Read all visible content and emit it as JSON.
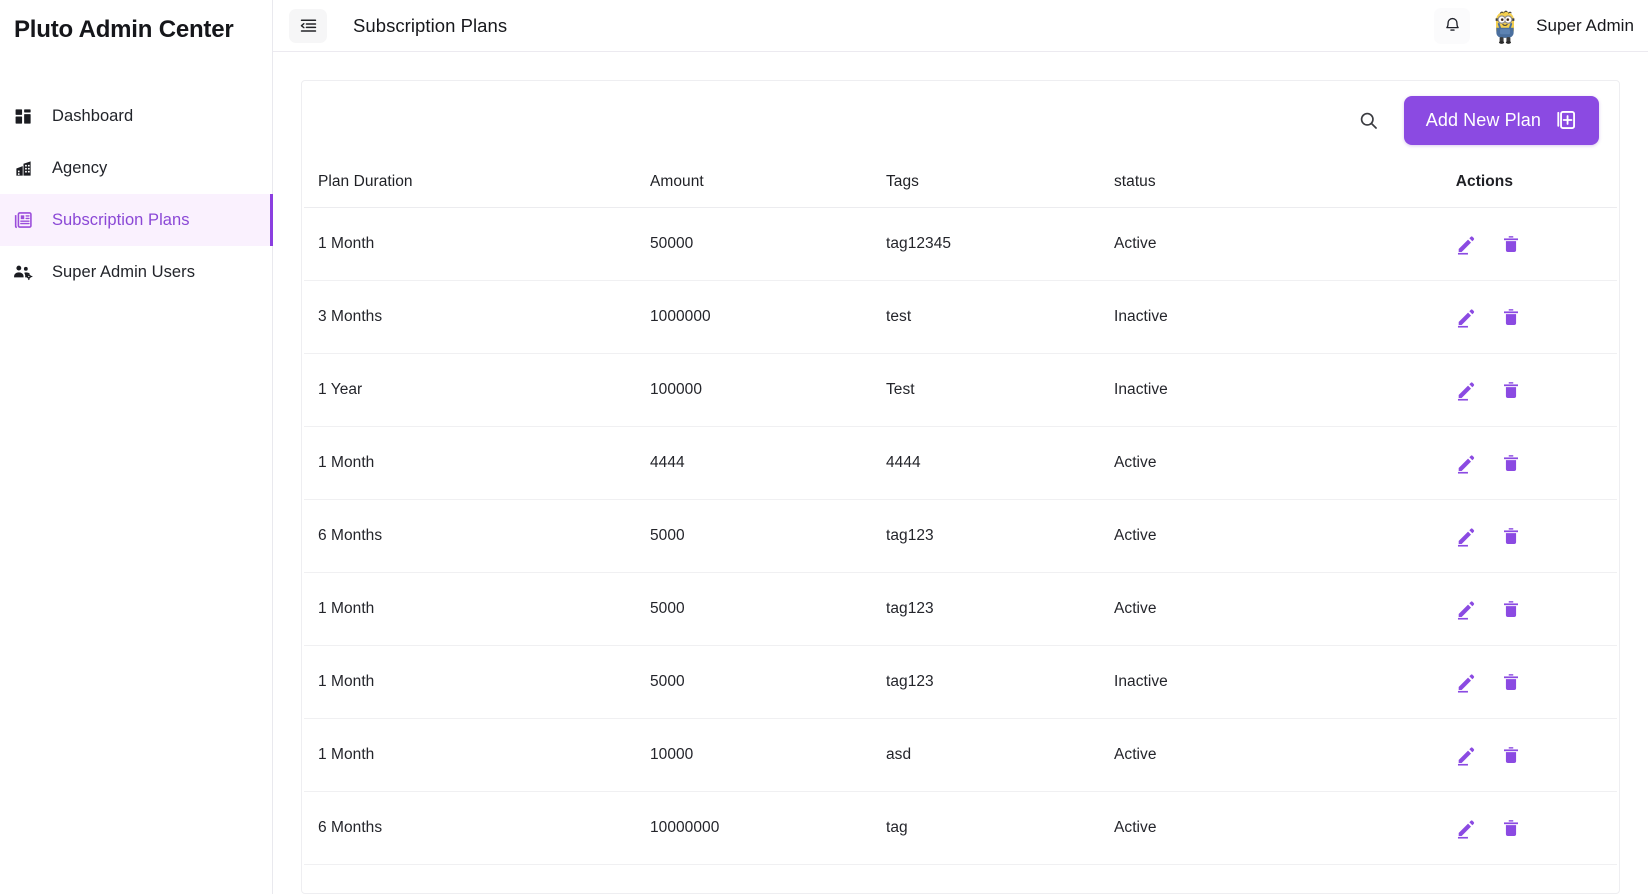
{
  "sidebar": {
    "brand": "Pluto Admin Center",
    "items": [
      {
        "label": "Dashboard",
        "icon": "dashboard-icon",
        "active": false
      },
      {
        "label": "Agency",
        "icon": "building-icon",
        "active": false
      },
      {
        "label": "Subscription Plans",
        "icon": "newspaper-icon",
        "active": true
      },
      {
        "label": "Super Admin Users",
        "icon": "people-gear-icon",
        "active": false
      }
    ]
  },
  "topbar": {
    "collapse_icon": "menu-collapse-icon",
    "title": "Subscription Plans",
    "bell_icon": "bell-icon",
    "avatar_icon": "minion-avatar",
    "user_name": "Super Admin"
  },
  "toolbar": {
    "search_icon": "search-icon",
    "add_label": "Add New Plan",
    "add_icon": "library-add-icon"
  },
  "table": {
    "columns": [
      "Plan Duration",
      "Amount",
      "Tags",
      "status",
      "Actions"
    ],
    "row_actions": {
      "edit_icon": "edit-pencil-icon",
      "delete_icon": "trash-icon"
    },
    "rows": [
      {
        "duration": "1 Month",
        "amount": "50000",
        "tags": "tag12345",
        "status": "Active"
      },
      {
        "duration": "3 Months",
        "amount": "1000000",
        "tags": "test",
        "status": "Inactive"
      },
      {
        "duration": "1 Year",
        "amount": "100000",
        "tags": "Test",
        "status": "Inactive"
      },
      {
        "duration": "1 Month",
        "amount": "4444",
        "tags": "4444",
        "status": "Active"
      },
      {
        "duration": "6 Months",
        "amount": "5000",
        "tags": "tag123",
        "status": "Active"
      },
      {
        "duration": "1 Month",
        "amount": "5000",
        "tags": "tag123",
        "status": "Active"
      },
      {
        "duration": "1 Month",
        "amount": "5000",
        "tags": "tag123",
        "status": "Inactive"
      },
      {
        "duration": "1 Month",
        "amount": "10000",
        "tags": "asd",
        "status": "Active"
      },
      {
        "duration": "6 Months",
        "amount": "10000000",
        "tags": "tag",
        "status": "Active"
      }
    ]
  },
  "colors": {
    "accent": "#8b4ae2",
    "accent_soft_bg": "#faf1fe",
    "accent_text": "#8b48d6",
    "text": "#24252b",
    "border": "#eeeef1"
  }
}
